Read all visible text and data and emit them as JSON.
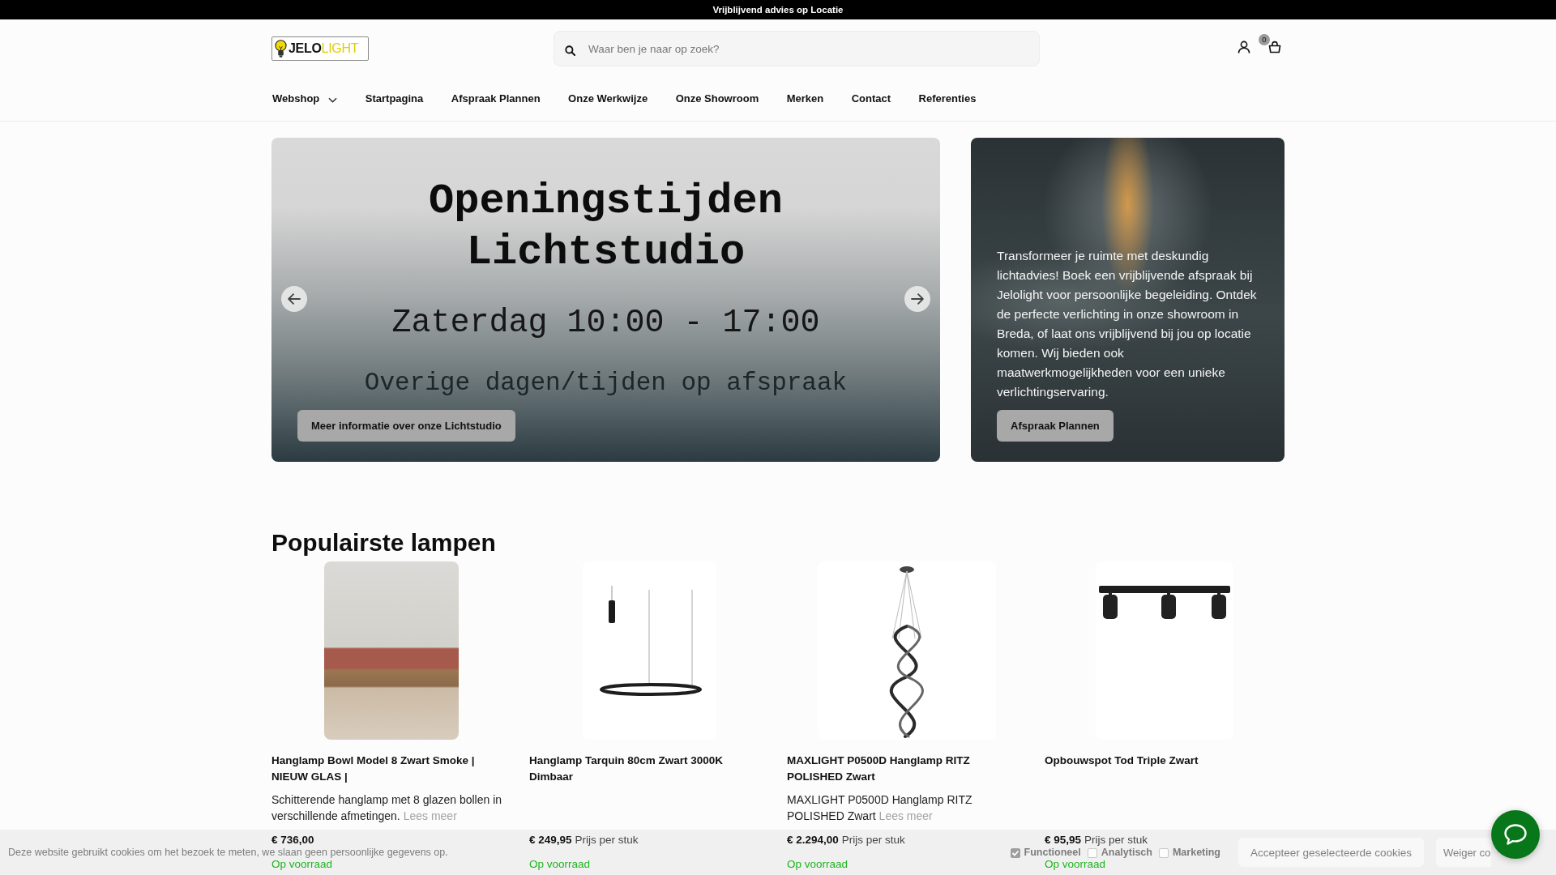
{
  "top_bar": {
    "text": "Vrijblijvend advies op Locatie"
  },
  "header": {
    "logo": {
      "text": "JELO",
      "accent": "LIGHT"
    },
    "search": {
      "placeholder": "Waar ben je naar op zoek?"
    },
    "cart": {
      "count": "0"
    }
  },
  "nav": [
    {
      "label": "Webshop",
      "dropdown": true
    },
    {
      "label": "Startpagina",
      "dropdown": false
    },
    {
      "label": "Afspraak Plannen",
      "dropdown": false
    },
    {
      "label": "Onze Werkwijze",
      "dropdown": false
    },
    {
      "label": "Onze Showroom",
      "dropdown": false
    },
    {
      "label": "Merken",
      "dropdown": false
    },
    {
      "label": "Contact",
      "dropdown": false
    },
    {
      "label": "Referenties",
      "dropdown": false
    }
  ],
  "hero": {
    "slide": {
      "lines": [
        {
          "kind": "title",
          "text": "Openingstijden"
        },
        {
          "kind": "title",
          "text": "Lichtstudio"
        },
        {
          "kind": "time",
          "text": "Zaterdag 10:00 - 17:00"
        },
        {
          "kind": "note",
          "text": "Overige dagen/tijden op afspraak"
        }
      ],
      "button": "Meer informatie over onze Lichtstudio"
    },
    "promo": {
      "text": "Transformeer je ruimte met deskundig lichtadvies! Boek een vrijblijvende afspraak bij Jelolight voor persoonlijke begeleiding. Ontdek de perfecte verlichting in onze showroom in Breda, of laat ons vrijblijvend bij jou op locatie komen. Wij bieden ook maatwerkmogelijkheden voor een unieke verlichtingservaring.",
      "button": "Afspraak Plannen"
    }
  },
  "section": {
    "title": "Populairste lampen"
  },
  "products": [
    {
      "kind": "photo",
      "name": "Hanglamp Bowl Model 8 Zwart Smoke | NIEUW GLAS |",
      "description": "Schitterende hanglamp met 8 glazen bollen in verschillende afmetingen.",
      "more": "Lees meer",
      "price": "€ 736,00",
      "stock": "Op voorraad"
    },
    {
      "kind": "ring",
      "name": "Hanglamp Tarquin 80cm Zwart 3000K Dimbaar",
      "price": "€ 249,95",
      "unit": "Prijs per stuk",
      "stock": "Op voorraad"
    },
    {
      "kind": "spiral",
      "name": "MAXLIGHT P0500D Hanglamp RITZ POLISHED Zwart",
      "description": "MAXLIGHT P0500D Hanglamp RITZ POLISHED Zwart",
      "more": "Lees meer",
      "price": "€ 2.294,00",
      "unit": "Prijs per stuk",
      "stock": "Op voorraad"
    },
    {
      "kind": "spots",
      "name": "Opbouwspot Tod Triple Zwart",
      "price": "€ 95,95",
      "unit": "Prijs per stuk",
      "stock": "Op voorraad"
    }
  ],
  "cookie_bar": {
    "text": "Deze website gebruikt cookies om het bezoek te meten, we slaan geen persoonlijke gegevens op.",
    "options": [
      {
        "label": "Functioneel",
        "checked": true
      },
      {
        "label": "Analytisch",
        "checked": false
      },
      {
        "label": "Marketing",
        "checked": false
      }
    ],
    "buttons": [
      "Accepteer geselecteerde cookies",
      "Weiger co"
    ]
  }
}
